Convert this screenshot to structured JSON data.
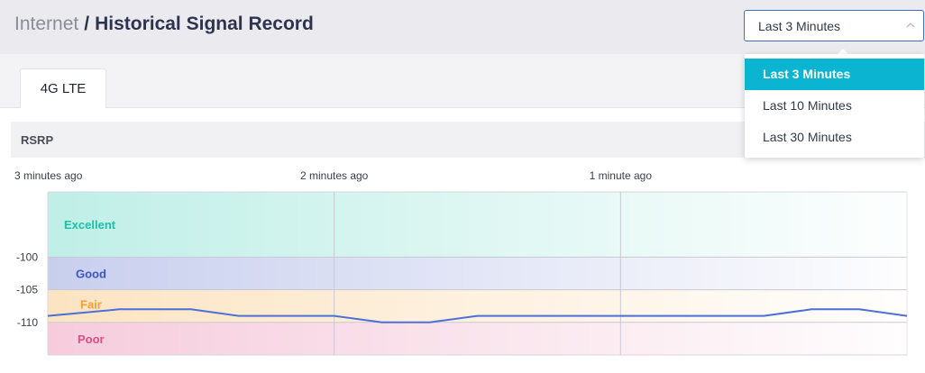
{
  "breadcrumb": {
    "parent": "Internet",
    "separator": "/",
    "current": "Historical Signal Record"
  },
  "time_range_select": {
    "value": "Last 3 Minutes",
    "options": [
      {
        "label": "Last 3 Minutes",
        "selected": true
      },
      {
        "label": "Last 10 Minutes",
        "selected": false
      },
      {
        "label": "Last 30 Minutes",
        "selected": false
      }
    ]
  },
  "tabs": [
    {
      "label": "4G LTE",
      "active": true
    }
  ],
  "section": {
    "title": "RSRP"
  },
  "chart_data": {
    "type": "line",
    "title": "RSRP",
    "x_tick_labels": [
      "3 minutes ago",
      "2 minutes ago",
      "1 minute ago"
    ],
    "y_tick_labels": [
      "-100",
      "-105",
      "-110"
    ],
    "ylim": [
      -115,
      -90
    ],
    "grid": true,
    "bands": [
      {
        "label": "Excellent",
        "from": -90,
        "to": -100,
        "color": "#2ccab0",
        "label_color": "#1fbfa8"
      },
      {
        "label": "Good",
        "from": -100,
        "to": -105,
        "color": "#4a5fc8",
        "label_color": "#3f55c1"
      },
      {
        "label": "Fair",
        "from": -105,
        "to": -110,
        "color": "#f6a536",
        "label_color": "#f5a032"
      },
      {
        "label": "Poor",
        "from": -110,
        "to": -115,
        "color": "#e2568a",
        "label_color": "#e04e86"
      }
    ],
    "series": [
      {
        "color": "#4e6fd6",
        "x_seconds_ago": [
          180,
          165,
          150,
          140,
          120,
          110,
          100,
          90,
          80,
          70,
          60,
          50,
          40,
          30,
          20,
          10,
          0
        ],
        "values": [
          -109,
          -108,
          -108,
          -109,
          -109,
          -110,
          -110,
          -109,
          -109,
          -109,
          -109,
          -109,
          -109,
          -109,
          -108,
          -108,
          -109
        ]
      }
    ]
  }
}
